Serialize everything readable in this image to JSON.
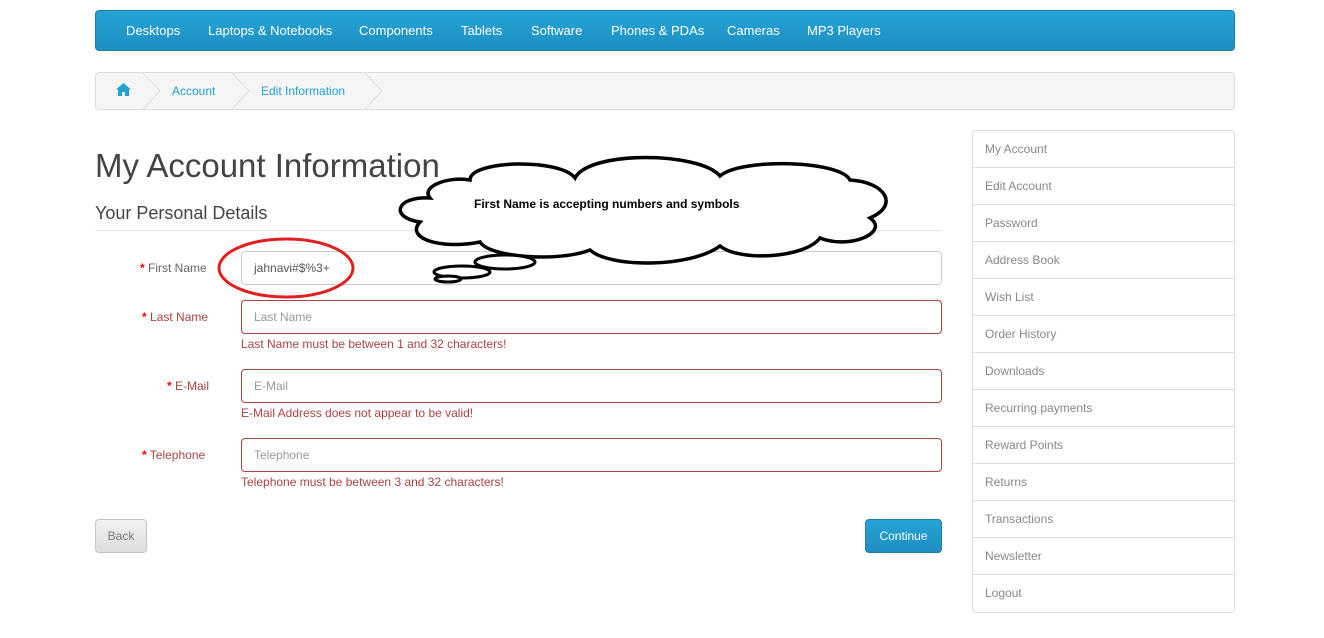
{
  "menu": {
    "items": [
      "Desktops",
      "Laptops & Notebooks",
      "Components",
      "Tablets",
      "Software",
      "Phones & PDAs",
      "Cameras",
      "MP3 Players"
    ]
  },
  "breadcrumb": {
    "home_icon": "home-icon",
    "items": [
      "Account",
      "Edit Information"
    ]
  },
  "page": {
    "title": "My Account Information",
    "section": "Your Personal Details"
  },
  "form": {
    "required_mark": "*",
    "first_name": {
      "label": "First Name",
      "value": "jahnavi#$%3+"
    },
    "last_name": {
      "label": "Last Name",
      "placeholder": "Last Name",
      "error": "Last Name must be between 1 and 32 characters!"
    },
    "email": {
      "label": "E-Mail",
      "placeholder": "E-Mail",
      "error": "E-Mail Address does not appear to be valid!"
    },
    "telephone": {
      "label": "Telephone",
      "placeholder": "Telephone",
      "error": "Telephone must be between 3 and 32 characters!"
    },
    "back_label": "Back",
    "continue_label": "Continue"
  },
  "sidebar": {
    "items": [
      "My Account",
      "Edit Account",
      "Password",
      "Address Book",
      "Wish List",
      "Order History",
      "Downloads",
      "Recurring payments",
      "Reward Points",
      "Returns",
      "Transactions",
      "Newsletter",
      "Logout"
    ]
  },
  "annotation": {
    "note": "First Name is accepting numbers and symbols"
  },
  "colors": {
    "accent": "#229ac8",
    "error": "#a94442",
    "required": "#ff0000",
    "annotation_circle": "#e02020"
  }
}
